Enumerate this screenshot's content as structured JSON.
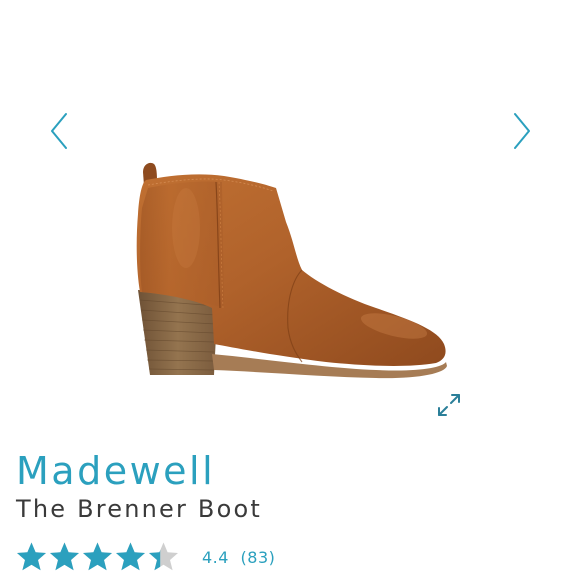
{
  "product": {
    "brand": "Madewell",
    "name": "The Brenner Boot",
    "image_alt": "brown leather ankle boot"
  },
  "rating": {
    "value": "4.4",
    "count": "(83)",
    "stars_out_of": 5,
    "stars_value": 4.4
  },
  "icons": {
    "prev": "chevron-left-icon",
    "next": "chevron-right-icon",
    "expand": "expand-icon",
    "star": "star-icon"
  },
  "colors": {
    "accent": "#2ba0be",
    "star_empty": "#cfcfcf",
    "text_dark": "#3a3a3a",
    "leather": "#b0622b",
    "heel": "#8a6846"
  }
}
